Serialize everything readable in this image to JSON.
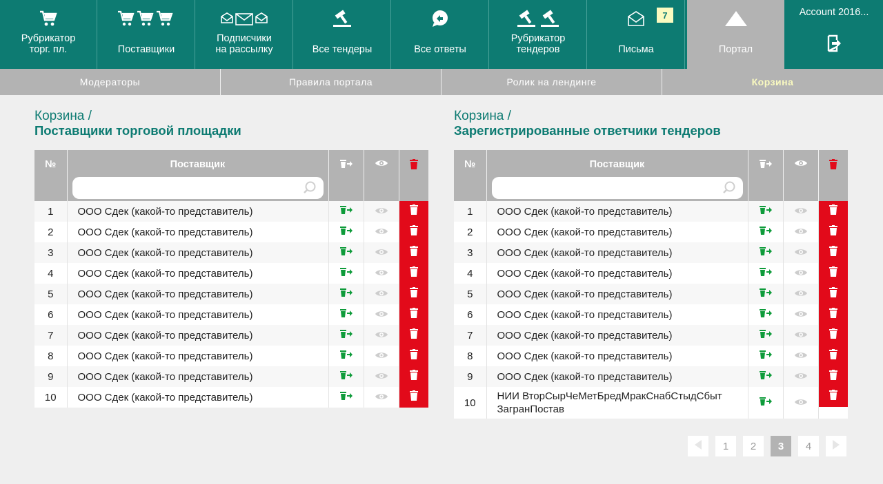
{
  "topnav": {
    "items": [
      {
        "label": "Рубрикатор\nторг. пл.",
        "icon": "cart-icon"
      },
      {
        "label": "Поставщики",
        "icon": "carts-icon"
      },
      {
        "label": "Подписчики\nна рассылку",
        "icon": "envelopes-icon"
      },
      {
        "label": "Все тендеры",
        "icon": "gavel-icon"
      },
      {
        "label": "Все ответы",
        "icon": "reply-bubble-icon"
      },
      {
        "label": "Рубрикатор\nтендеров",
        "icon": "gavels-icon"
      },
      {
        "label": "Письма",
        "icon": "envelope-icon",
        "badge": "7"
      },
      {
        "label": "Портал",
        "icon": "triangle-icon",
        "active": true
      }
    ],
    "account": "Account 2016..."
  },
  "subnav": {
    "items": [
      "Модераторы",
      "Правила портала",
      "Ролик на лендинге",
      "Корзина"
    ],
    "active": "Корзина"
  },
  "left_panel": {
    "crumb": "Корзина /",
    "title": "Поставщики торговой площадки",
    "columns": {
      "num": "№",
      "name": "Поставщик"
    },
    "search_placeholder": "",
    "rows": [
      {
        "num": "1",
        "name": "ООО Сдек (какой-то представитель)"
      },
      {
        "num": "2",
        "name": "ООО Сдек (какой-то представитель)"
      },
      {
        "num": "3",
        "name": "ООО Сдек (какой-то представитель)"
      },
      {
        "num": "4",
        "name": "ООО Сдек (какой-то представитель)"
      },
      {
        "num": "5",
        "name": "ООО Сдек (какой-то представитель)"
      },
      {
        "num": "6",
        "name": "ООО Сдек (какой-то представитель)"
      },
      {
        "num": "7",
        "name": "ООО Сдек (какой-то представитель)"
      },
      {
        "num": "8",
        "name": "ООО Сдек (какой-то представитель)"
      },
      {
        "num": "9",
        "name": "ООО Сдек (какой-то представитель)"
      },
      {
        "num": "10",
        "name": "ООО Сдек (какой-то представитель)"
      }
    ]
  },
  "right_panel": {
    "crumb": "Корзина /",
    "title": "Зарегистрированные ответчики тендеров",
    "columns": {
      "num": "№",
      "name": "Поставщик"
    },
    "search_placeholder": "",
    "rows": [
      {
        "num": "1",
        "name": "ООО Сдек (какой-то представитель)"
      },
      {
        "num": "2",
        "name": "ООО Сдек (какой-то представитель)"
      },
      {
        "num": "3",
        "name": "ООО Сдек (какой-то представитель)"
      },
      {
        "num": "4",
        "name": "ООО Сдек (какой-то представитель)"
      },
      {
        "num": "5",
        "name": "ООО Сдек (какой-то представитель)"
      },
      {
        "num": "6",
        "name": "ООО Сдек (какой-то представитель)"
      },
      {
        "num": "7",
        "name": "ООО Сдек (какой-то представитель)"
      },
      {
        "num": "8",
        "name": "ООО Сдек (какой-то представитель)"
      },
      {
        "num": "9",
        "name": "ООО Сдек (какой-то представитель)"
      },
      {
        "num": "10",
        "name": "НИИ ВторСырЧеМетБредМракСнабСтыдСбыт ЗагранПостав"
      }
    ]
  },
  "pagination": {
    "pages": [
      "1",
      "2",
      "3",
      "4"
    ],
    "current": "3"
  },
  "colors": {
    "brand": "#0d7b72",
    "restore": "#0e9b3a",
    "delete": "#e20a1a",
    "badge": "#fafac0"
  }
}
